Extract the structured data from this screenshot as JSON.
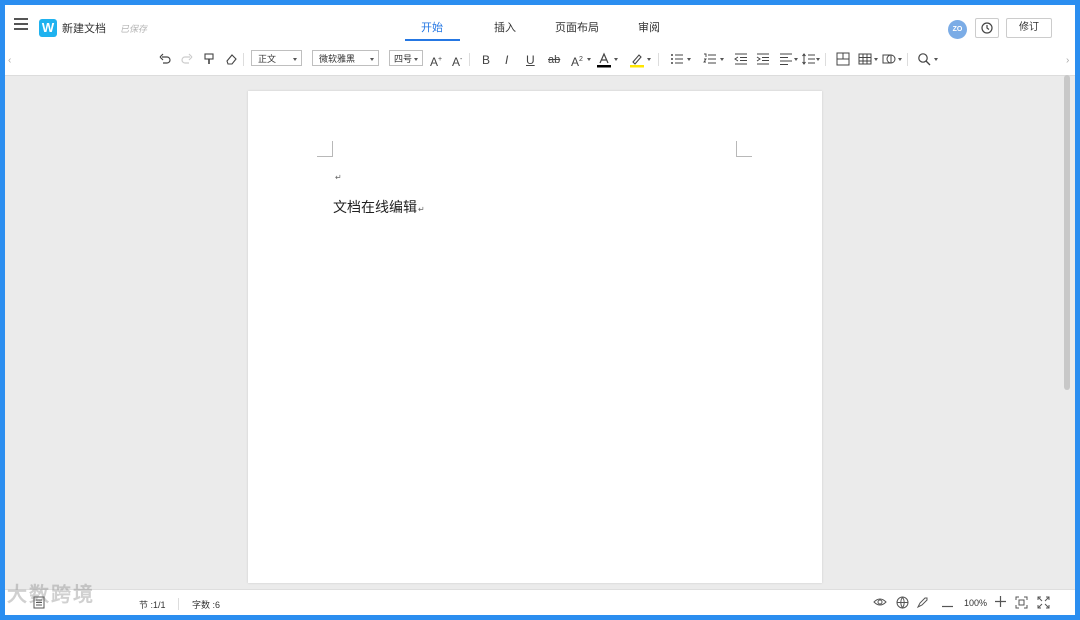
{
  "header": {
    "app_logo_letter": "W",
    "doc_title": "新建文档",
    "save_status": "已保存",
    "tabs": [
      {
        "label": "开始",
        "active": true
      },
      {
        "label": "插入",
        "active": false
      },
      {
        "label": "页面布局",
        "active": false
      },
      {
        "label": "审阅",
        "active": false
      }
    ],
    "avatar_initials": "ZO",
    "revise_label": "修订"
  },
  "toolbar": {
    "style_select": "正文",
    "font_select": "微软雅黑",
    "size_select": "四号",
    "font_color": "#000000",
    "highlight_color": "#ffe600"
  },
  "document": {
    "paragraph_mark": "↵",
    "body_text": "文档在线编辑"
  },
  "statusbar": {
    "section": "节 :1/1",
    "word_count": "字数 :6",
    "zoom": "100%"
  },
  "watermark": "大数跨境",
  "colors": {
    "frame": "#2b8ef0",
    "accent": "#2577e3",
    "logo": "#1fb2ef",
    "avatar": "#7bace6"
  }
}
